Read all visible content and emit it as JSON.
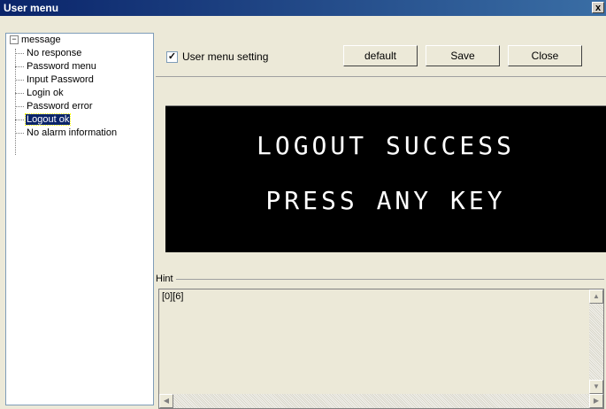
{
  "window": {
    "title": "User menu",
    "close_glyph": "x"
  },
  "tree": {
    "root": {
      "label": "message",
      "toggle": "−"
    },
    "items": [
      {
        "label": "No response"
      },
      {
        "label": "Password menu"
      },
      {
        "label": "Input Password"
      },
      {
        "label": "Login ok"
      },
      {
        "label": "Password error"
      },
      {
        "label": "Logout ok",
        "selected": true
      },
      {
        "label": "No alarm information"
      }
    ]
  },
  "toolbar": {
    "checkbox_label": "User menu setting",
    "checkbox_checked": true,
    "checkbox_mark": "✓",
    "default_label": "default",
    "save_label": "Save",
    "close_label": "Close"
  },
  "display": {
    "line1": "LOGOUT SUCCESS",
    "line2": "PRESS ANY KEY"
  },
  "hint": {
    "label": "Hint",
    "text": "[0][6]"
  },
  "icons": {
    "scroll_up": "triangle-up-icon",
    "scroll_down": "triangle-down-icon",
    "scroll_left": "triangle-left-icon",
    "scroll_right": "triangle-right-icon"
  }
}
